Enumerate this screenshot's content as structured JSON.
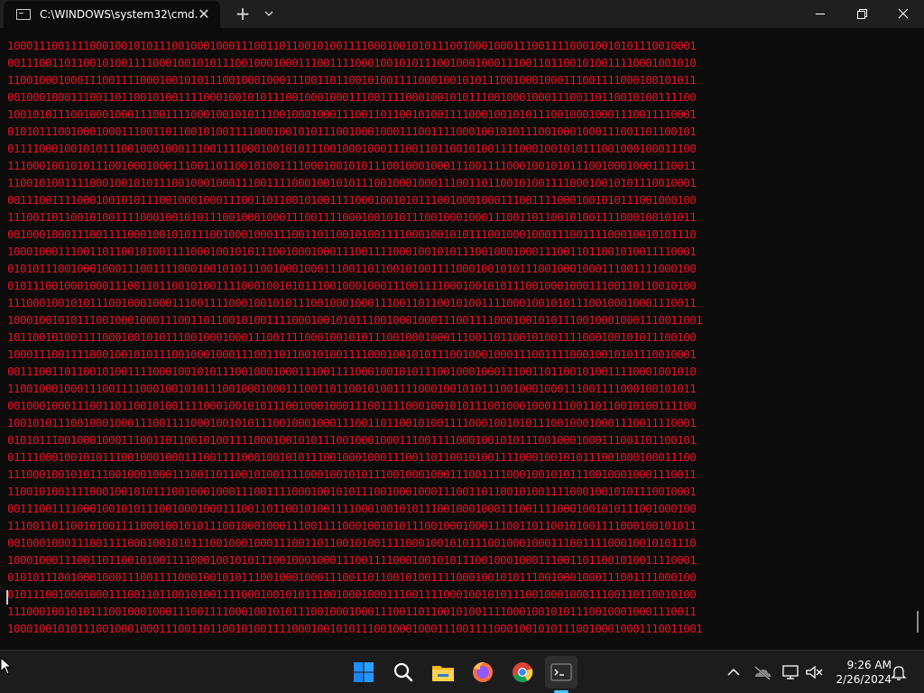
{
  "window": {
    "tab_title": "C:\\WINDOWS\\system32\\cmd.",
    "tab_close": "✕",
    "new_tab": "+"
  },
  "terminal": {
    "text_color": "#e81123",
    "background": "#0c0c0c",
    "lines": [
      "1000111001111000100101011100100010001110011011001010011110001001010111001000100011100111100010010101110010001",
      "0011100110110010100111100010010101110010001000111001111000100101011100100010001110011011001010011110001001010",
      "1100100010001110011110001001010111001000100011100110110010100111100010010101110010001000111001111000100101011",
      "0010001000111001101100101001111000100101011100100010001110011110001001010111001000100011100110110010100111100",
      "1001010111001000100011100111100010010101110010001000111001101100101001111000100101011100100010001110011110001",
      "0101011100100010001110011011001010011110001001010111001000100011100111100010010101110010001000111001101100101",
      "0111100010010101110010001000111001111000100101011100100010001110011011001010011110001001010111001000100011100",
      "1110001001010111001000100011100110110010100111100010010101110010001000111001111000100101011100100010001110011",
      "1100101001111000100101011100100010001110011110001001010111001000100011100110110010100111100010010101110010001",
      "0011100111100010010101110010001000111001101100101001111000100101011100100010001110011110001001010111001000100",
      "1110011011001010011110001001010111001000100011100111100010010101110010001000111001101100101001111000100101011",
      "0010001000111001111000100101011100100010001110011011001010011110001001010111001000100011100111100010010101110",
      "1000100011100110110010100111100010010101110010001000111001111000100101011100100010001110011011001010011110001",
      "0101011100100010001110011110001001010111001000100011100110110010100111100010010101110010001000111001111000100",
      "0101110010001000111001101100101001111000100101011100100010001110011110001001010111001000100011100110110010100",
      "1110001001010111001000100011100111100010010101110010001000111001101100101001111000100101011100100010001110011",
      "10001001010111001000100011100110110010100111100010010101110010001000111001111000100101011100100010001110011001",
      "1011001010011110001001010111001000100011100111100010010101110010001000111001101100101001111000100101011100100",
      "1000111001111000100101011100100010001110011011001010011110001001010111001000100011100111100010010101110010001",
      "0011100110110010100111100010010101110010001000111001111000100101011100100010001110011011001010011110001001010",
      "1100100010001110011110001001010111001000100011100110110010100111100010010101110010001000111001111000100101011",
      "0010001000111001101100101001111000100101011100100010001110011110001001010111001000100011100110110010100111100",
      "1001010111001000100011100111100010010101110010001000111001101100101001111000100101011100100010001110011110001",
      "0101011100100010001110011011001010011110001001010111001000100011100111100010010101110010001000111001101100101",
      "0111100010010101110010001000111001111000100101011100100010001110011011001010011110001001010111001000100011100",
      "1110001001010111001000100011100110110010100111100010010101110010001000111001111000100101011100100010001110011",
      "1100101001111000100101011100100010001110011110001001010111001000100011100110110010100111100010010101110010001",
      "0011100111100010010101110010001000111001101100101001111000100101011100100010001110011110001001010111001000100",
      "1110011011001010011110001001010111001000100011100111100010010101110010001000111001101100101001111000100101011",
      "0010001000111001111000100101011100100010001110011011001010011110001001010111001000100011100111100010010101110",
      "1000100011100110110010100111100010010101110010001000111001111000100101011100100010001110011011001010011110001",
      "0101011100100010001110011110001001010111001000100011100110110010100111100010010101110010001000111001111000100",
      "0101110010001000111001101100101001111000100101011100100010001110011110001001010111001000100011100110110010100",
      "1110001001010111001000100011100111100010010101110010001000111001101100101001111000100101011100100010001110011",
      "10001001010111001000100011100110110010100111100010010101110010001000111001111000100101011100100010001110011001"
    ]
  },
  "taskbar": {
    "icons": [
      "start-icon",
      "search-icon",
      "file-explorer-icon",
      "firefox-icon",
      "chrome-icon",
      "terminal-icon"
    ],
    "tray_icons": [
      "chevron-up-icon",
      "onedrive-icon",
      "network-icon",
      "volume-muted-icon",
      "notification-bell-icon"
    ],
    "time": "9:26 AM",
    "date": "2/26/2024",
    "accent_color": "#4cc2ff"
  }
}
